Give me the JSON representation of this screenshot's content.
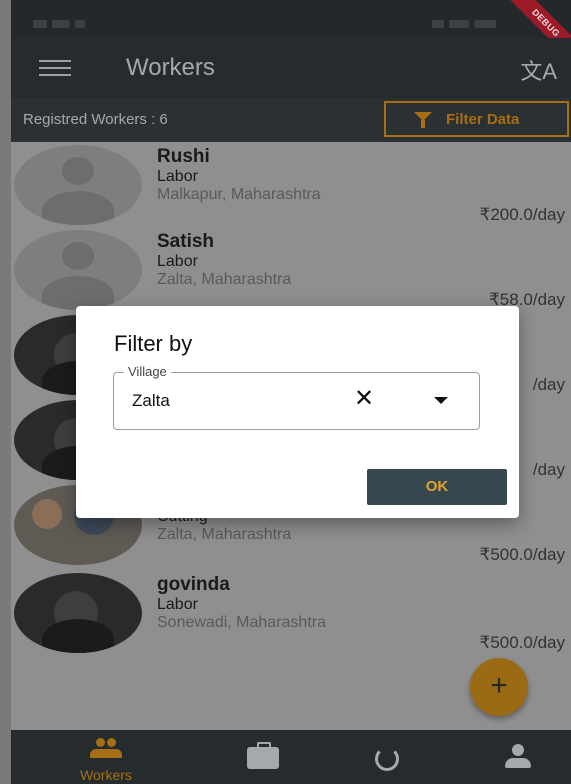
{
  "status_bar": {
    "debug_label": "DEBUG"
  },
  "app_bar": {
    "title": "Workers",
    "menu_icon": "menu-icon",
    "translate_icon": "translate-icon"
  },
  "sub_bar": {
    "count_label": "Registred Workers : 6",
    "filter_button": "Filter Data"
  },
  "workers": [
    {
      "name": "Rushi",
      "role": "Labor",
      "location": "Malkapur, Maharashtra",
      "rate": "₹200.0/day",
      "avatar": "placeholder"
    },
    {
      "name": "Satish",
      "role": "Labor",
      "location": "Zalta, Maharashtra",
      "rate": "₹58.0/day",
      "avatar": "placeholder"
    },
    {
      "name": "",
      "role": "",
      "location": "",
      "rate": "/day",
      "avatar": "photo"
    },
    {
      "name": "",
      "role": "",
      "location": "",
      "rate": "/day",
      "avatar": "photo"
    },
    {
      "name": "",
      "role": "Cutting",
      "location": "Zalta, Maharashtra",
      "rate": "₹500.0/day",
      "avatar": "group"
    },
    {
      "name": "govinda",
      "role": "Labor",
      "location": "Sonewadi, Maharashtra",
      "rate": "₹500.0/day",
      "avatar": "photo"
    }
  ],
  "fab": {
    "label": "+"
  },
  "bottom_nav": {
    "items": [
      {
        "label": "Workers",
        "icon": "people-icon",
        "active": true
      },
      {
        "label": "",
        "icon": "briefcase-icon",
        "active": false
      },
      {
        "label": "",
        "icon": "cycle-icon",
        "active": false
      },
      {
        "label": "",
        "icon": "person-icon",
        "active": false
      }
    ]
  },
  "dialog": {
    "title": "Filter by",
    "field_label": "Village",
    "field_value": "Zalta",
    "clear_glyph": "✕",
    "ok_label": "OK"
  },
  "colors": {
    "accent": "#a76f13",
    "dialog_button": "#37474f",
    "ok_text": "#e0a52e"
  }
}
